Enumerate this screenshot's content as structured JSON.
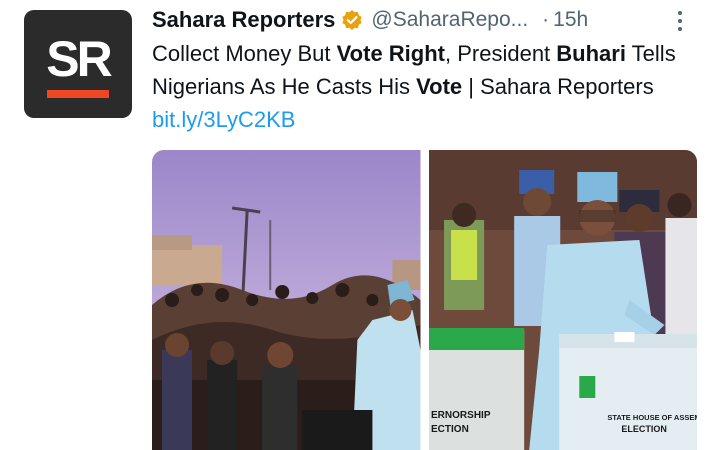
{
  "author": {
    "name": "Sahara Reporters",
    "handle": "@SaharaRepo...",
    "separator": "·",
    "time": "15h",
    "avatar_text": "SR",
    "verified": true
  },
  "tweet": {
    "segments": [
      {
        "text": "Collect Money But ",
        "bold": false
      },
      {
        "text": "Vote Right",
        "bold": true
      },
      {
        "text": ", President ",
        "bold": false
      },
      {
        "text": "Buhari",
        "bold": true
      },
      {
        "text": " Tells Nigerians As He Casts His ",
        "bold": false
      },
      {
        "text": "Vote",
        "bold": true
      },
      {
        "text": " | Sahara Reporters ",
        "bold": false
      }
    ],
    "link": "bit.ly/3LyC2KB"
  },
  "media": {
    "left_alt": "Crowd gathered at polling unit",
    "right_alt": "President casting vote into ballot box",
    "box_label_left_1": "ERNORSHIP",
    "box_label_left_2": "ECTION",
    "box_label_right_1": "STATE HOUSE OF ASSEMBLY",
    "box_label_right_2": "ELECTION"
  },
  "colors": {
    "link": "#1d9bf0",
    "muted": "#536471",
    "verified": "#e8a20c",
    "brand_bar": "#ef4723",
    "avatar_bg": "#2b2b2b"
  },
  "icons": {
    "verified": "verified-badge-icon",
    "more": "more-dots-icon"
  }
}
